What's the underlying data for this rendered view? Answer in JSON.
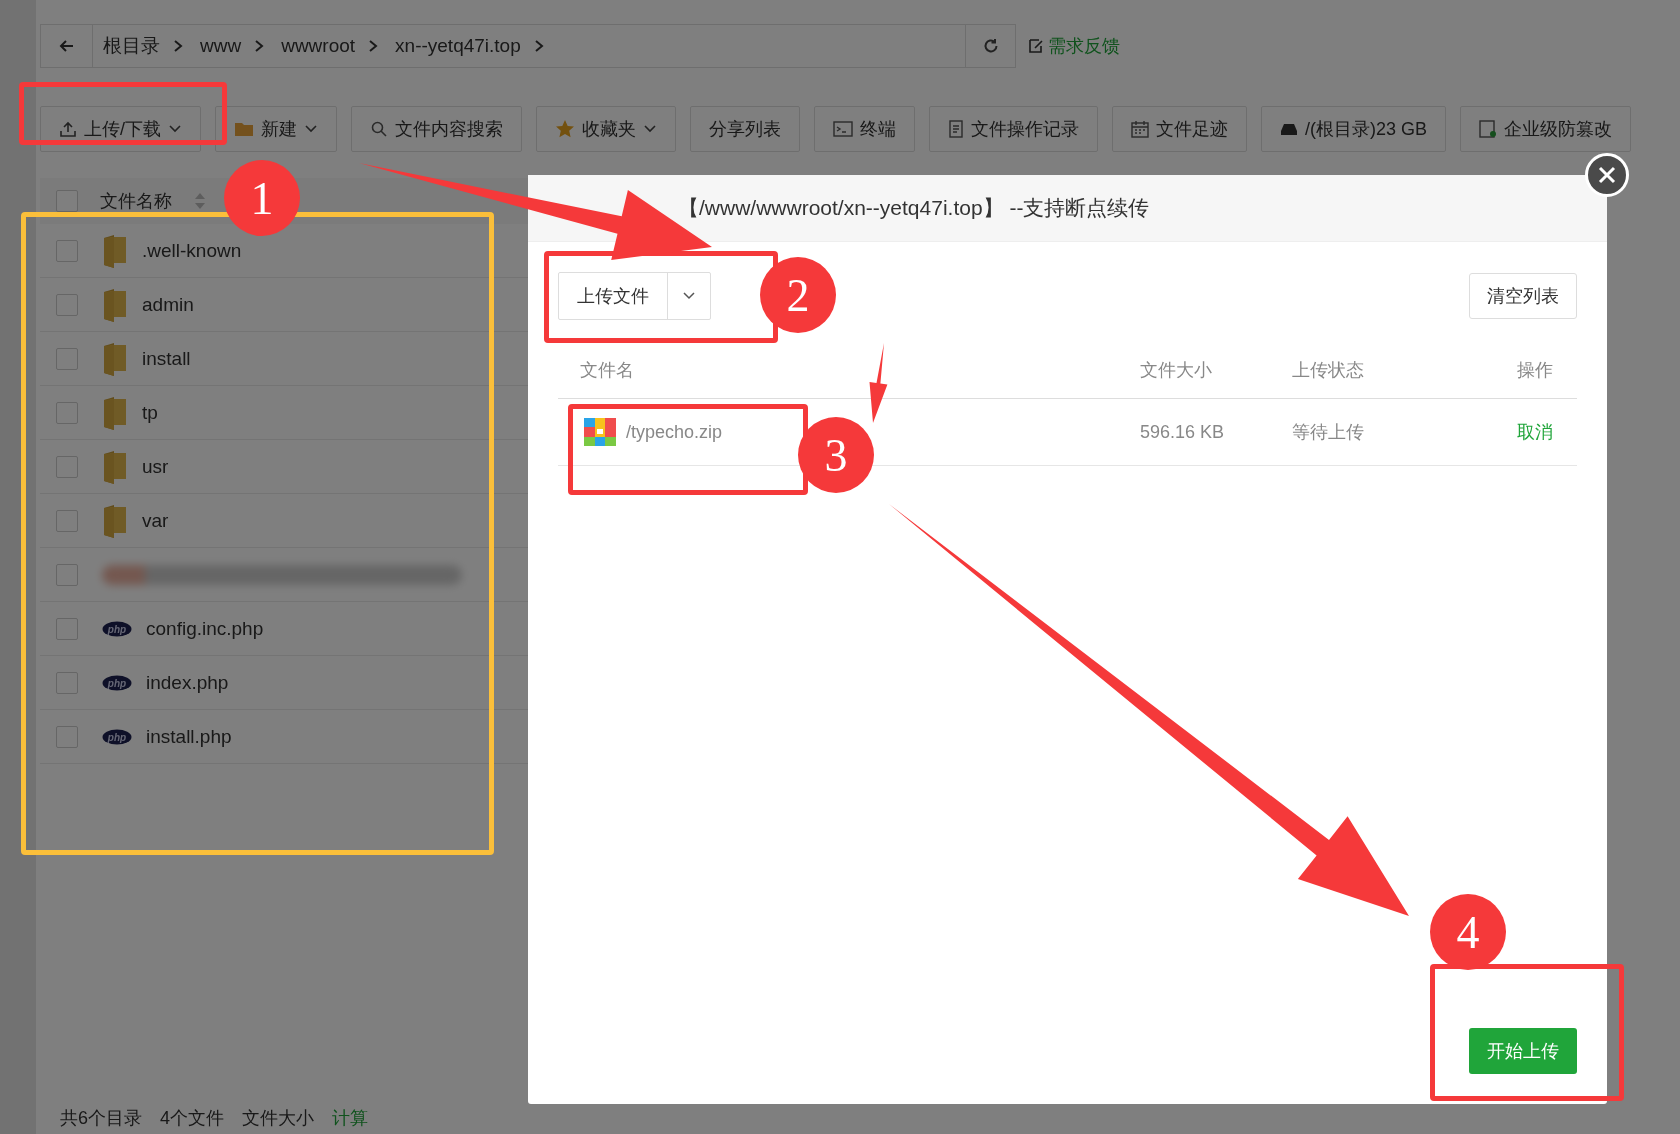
{
  "breadcrumb": {
    "segments": [
      "根目录",
      "www",
      "wwwroot",
      "xn--yetq47i.top"
    ],
    "feedback": "需求反馈"
  },
  "toolbar": [
    {
      "label": "上传/下载",
      "dropdown": true
    },
    {
      "label": "新建",
      "dropdown": true
    },
    {
      "label": "文件内容搜索",
      "dropdown": false
    },
    {
      "label": "收藏夹",
      "dropdown": true
    },
    {
      "label": "分享列表",
      "dropdown": false
    },
    {
      "label": "终端",
      "dropdown": false
    },
    {
      "label": "文件操作记录",
      "dropdown": false
    },
    {
      "label": "文件足迹",
      "dropdown": false
    },
    {
      "label": "/(根目录)23 GB",
      "dropdown": false
    },
    {
      "label": "企业级防篡改",
      "dropdown": false
    }
  ],
  "file_list": {
    "header": "文件名称",
    "select_all_checked": false,
    "rows": [
      {
        "kind": "folder",
        "name": ".well-known",
        "checked": false
      },
      {
        "kind": "folder",
        "name": "admin",
        "checked": false
      },
      {
        "kind": "folder",
        "name": "install",
        "checked": false
      },
      {
        "kind": "folder",
        "name": "tp",
        "checked": false
      },
      {
        "kind": "folder",
        "name": "usr",
        "checked": false
      },
      {
        "kind": "folder",
        "name": "var",
        "checked": false
      },
      {
        "kind": "blurred",
        "checked": false
      },
      {
        "kind": "php",
        "name": "config.inc.php",
        "checked": false
      },
      {
        "kind": "php",
        "name": "index.php",
        "checked": false
      },
      {
        "kind": "php",
        "name": "install.php",
        "checked": false
      }
    ]
  },
  "status_bar": {
    "dirs": "共6个目录",
    "files": "4个文件",
    "size_label": "文件大小",
    "calc": "计算"
  },
  "modal": {
    "title": "【/www/wwwroot/xn--yetq47i.top】 --支持断点续传",
    "upload_button": "上传文件",
    "clear_button": "清空列表",
    "columns": [
      "文件名",
      "文件大小",
      "上传状态",
      "操作"
    ],
    "rows": [
      {
        "name": "/typecho.zip",
        "size": "596.16 KB",
        "status": "等待上传",
        "action": "取消"
      }
    ],
    "start_button": "开始上传"
  },
  "annotations": {
    "badges": [
      "1",
      "2",
      "3",
      "4"
    ],
    "boxes": [
      {
        "color": "#f5393a"
      },
      {
        "color": "#fbbf3a"
      },
      {
        "color": "#f5393a"
      },
      {
        "color": "#f5393a"
      },
      {
        "color": "#f5393a"
      }
    ]
  }
}
